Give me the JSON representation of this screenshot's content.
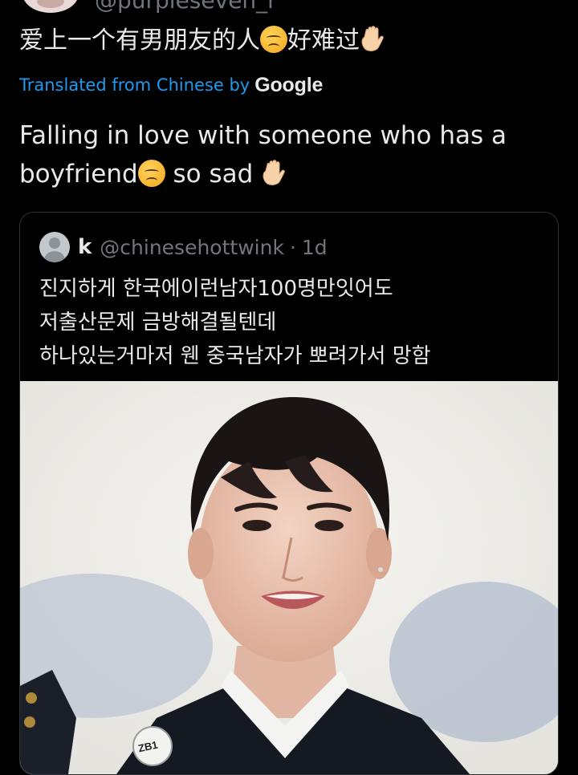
{
  "author": {
    "handle_partial": "@purpleseven_r"
  },
  "tweet": {
    "original_text": "爱上一个有男朋友的人",
    "original_text_end": "好难过",
    "emoji_1": "disappointed-face-icon",
    "emoji_2": "raised-hand-icon"
  },
  "translation_bar": {
    "label": "Translated from Chinese by",
    "provider": "Google"
  },
  "translation": {
    "line_1": "Falling in love with someone who has a",
    "line_2_start": "boyfriend",
    "line_2_end": " so sad"
  },
  "quote": {
    "name": "k",
    "handle": "@chinesehottwink",
    "separator": "·",
    "time": "1d",
    "lines": [
      "진지하게 한국에이런남자100명만잇어도",
      "저출산문제 금방해결될텐데",
      "하나있는거마저 웬 중국남자가 뽀려가서 망함"
    ],
    "image_badge_text": "ZB1"
  },
  "colors": {
    "background": "#000000",
    "text": "#e7e9ea",
    "link": "#1d9bf0",
    "muted": "#71767b",
    "border": "#2f3336"
  }
}
